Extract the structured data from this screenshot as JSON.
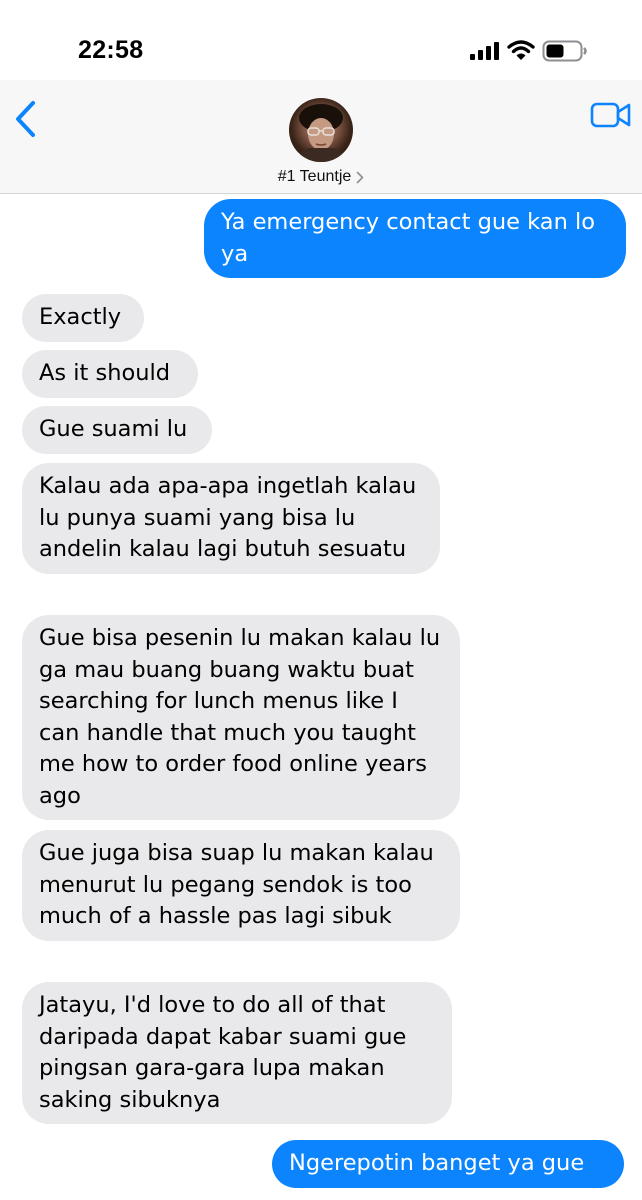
{
  "status_bar": {
    "time": "22:58",
    "icons": [
      "signal-icon",
      "wifi-icon",
      "battery-icon"
    ]
  },
  "header": {
    "contact_name": "#1 Teuntje",
    "icons": [
      "back-chevron-icon",
      "avatar",
      "chevron-right-icon",
      "video-camera-icon"
    ]
  },
  "colors": {
    "accent": "#0b84fe",
    "incoming_bubble": "#e9e9eb",
    "header_bg": "#f7f7f7"
  },
  "messages": [
    {
      "direction": "outgoing",
      "text": "Ya emergency contact gue kan lo ya"
    },
    {
      "direction": "incoming",
      "text": "Exactly"
    },
    {
      "direction": "incoming",
      "text": "As it should"
    },
    {
      "direction": "incoming",
      "text": "Gue suami lu"
    },
    {
      "direction": "incoming",
      "text": "Kalau ada apa-apa ingetlah kalau lu punya suami yang bisa lu andelin kalau lagi butuh sesuatu"
    },
    {
      "direction": "incoming",
      "text": "Gue bisa pesenin lu makan kalau lu ga mau buang buang waktu buat searching for lunch menus like I can handle that much you taught me how to order food online years ago"
    },
    {
      "direction": "incoming",
      "text": "Gue juga bisa suap lu makan kalau menurut lu pegang sendok is too much of a hassle pas lagi sibuk"
    },
    {
      "direction": "incoming",
      "text": "Jatayu, I'd love to do all of that daripada dapat kabar suami gue pingsan gara-gara lupa makan saking sibuknya"
    },
    {
      "direction": "outgoing",
      "text": "Ngerepotin banget ya gue"
    }
  ]
}
